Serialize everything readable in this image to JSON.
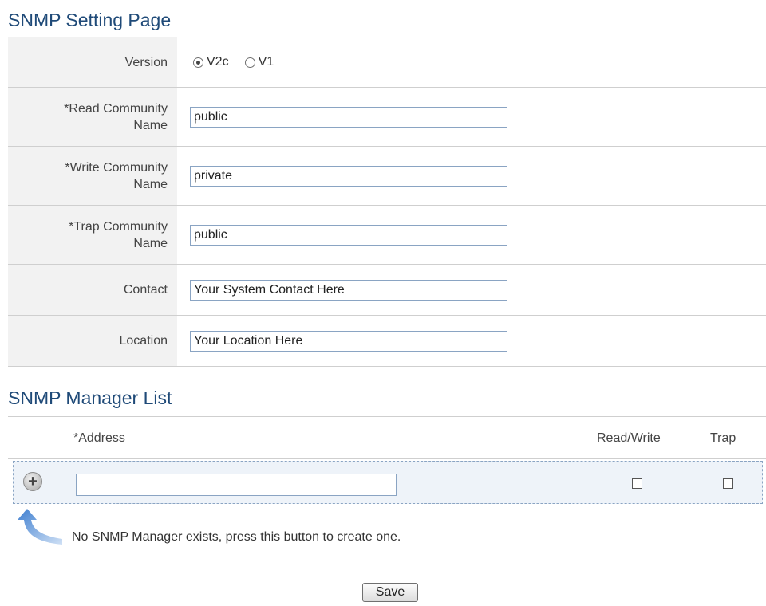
{
  "page_title": "SNMP Setting Page",
  "settings": {
    "version": {
      "label": "Version",
      "options": [
        "V2c",
        "V1"
      ],
      "selected": "V2c"
    },
    "read_community": {
      "label_line1": "*Read Community",
      "label_line2": "Name",
      "value": "public"
    },
    "write_community": {
      "label_line1": "*Write Community",
      "label_line2": "Name",
      "value": "private"
    },
    "trap_community": {
      "label_line1": "*Trap Community",
      "label_line2": "Name",
      "value": "public"
    },
    "contact": {
      "label": "Contact",
      "value": "Your System Contact Here"
    },
    "location": {
      "label": "Location",
      "value": "Your Location Here"
    }
  },
  "manager_list": {
    "title": "SNMP Manager List",
    "headers": {
      "address": "*Address",
      "read_write": "Read/Write",
      "trap": "Trap"
    },
    "new_row": {
      "address": "",
      "read_write": false,
      "trap": false
    },
    "hint": "No SNMP Manager exists, press this button to create one.",
    "add_icon": "plus-circle-icon"
  },
  "save_label": "Save",
  "colors": {
    "title": "#1f4a78",
    "label_bg": "#f2f2f2",
    "row_bg": "#eef3f9",
    "arrow": "#5f93d3"
  }
}
